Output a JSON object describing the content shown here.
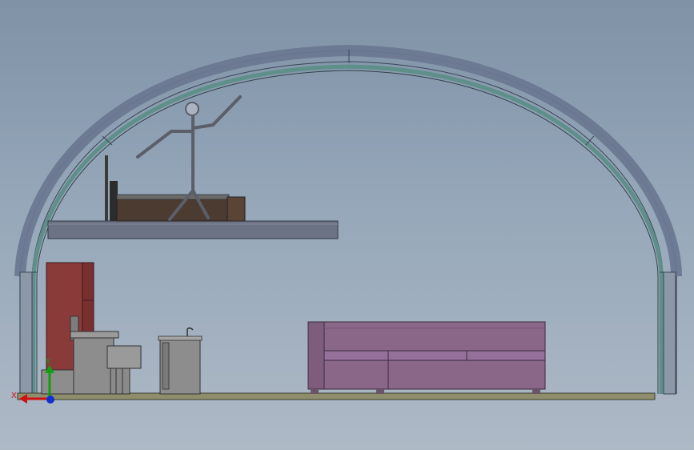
{
  "viewport": {
    "background_top": "#7f92a6",
    "background_bottom": "#aeb9c6"
  },
  "triad": {
    "x_label": "X",
    "y_label": "Y",
    "x_color": "#d01010",
    "y_color": "#10a010",
    "z_color": "#1030d0"
  },
  "colors": {
    "arch_outer": "#6d7a8e",
    "arch_inner": "#5c8a84",
    "loft": "#6c7384",
    "floor": "#8e8e6c",
    "fridge": "#8b3a3a",
    "appliance": "#8d8d8d",
    "sofa": "#8a6689",
    "bed": "#4b3b30",
    "figure": "#5a5f6a"
  },
  "icons": {
    "triad": "coordinate-triad-icon",
    "faucet": "faucet-icon"
  }
}
